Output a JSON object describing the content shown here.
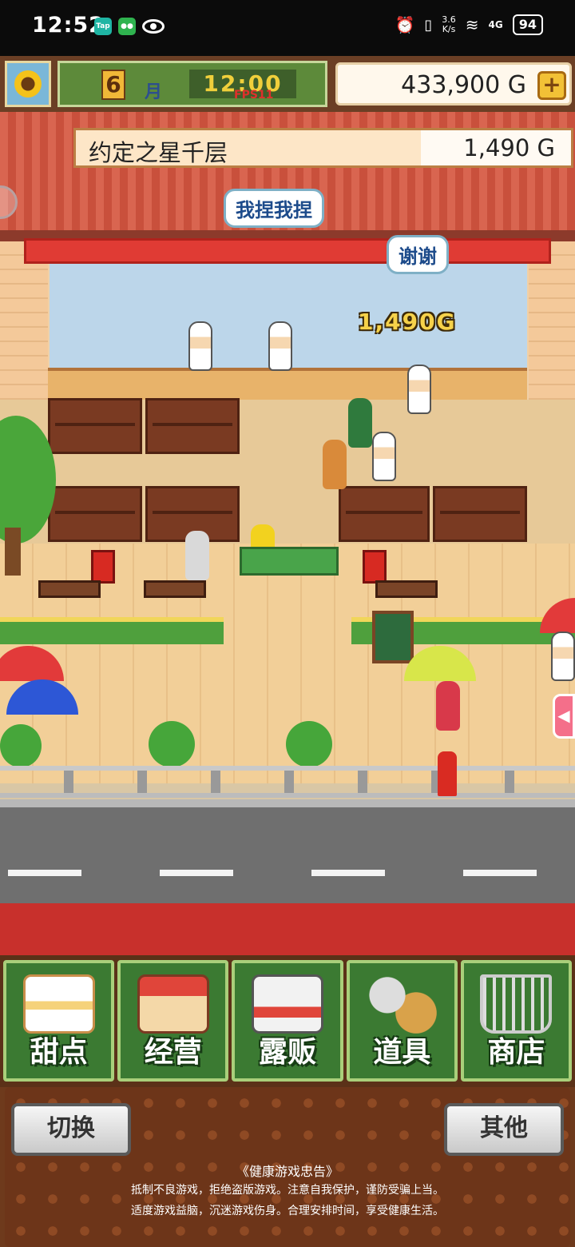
{
  "status_bar": {
    "time": "12:52",
    "speed_top": "3.6",
    "speed_unit": "K/s",
    "network": "4G",
    "battery": "94"
  },
  "hud": {
    "month_number": "6",
    "month_label": "月",
    "clock": "12:00",
    "fps": "FPS11",
    "money": "433,900 G",
    "plus": "+"
  },
  "scene": {
    "shop_name": "约定之星千层",
    "shop_revenue": "1,490 G",
    "bubble_1": "我捏我捏",
    "bubble_2": "谢谢",
    "earn_popup": "1,490G",
    "side_tab_arrow": "◀"
  },
  "menu": {
    "items": [
      {
        "label": "甜点",
        "icon": "cake-icon"
      },
      {
        "label": "经营",
        "icon": "shop-icon"
      },
      {
        "label": "露贩",
        "icon": "food-truck-icon"
      },
      {
        "label": "道具",
        "icon": "items-icon"
      },
      {
        "label": "商店",
        "icon": "cart-icon"
      }
    ]
  },
  "bottom": {
    "switch_label": "切换",
    "other_label": "其他",
    "notice_title": "《健康游戏忠告》",
    "notice_line1": "抵制不良游戏，拒绝盗版游戏。注意自我保护，谨防受骗上当。",
    "notice_line2": "适度游戏益脑，沉迷游戏伤身。合理安排时间，享受健康生活。"
  }
}
